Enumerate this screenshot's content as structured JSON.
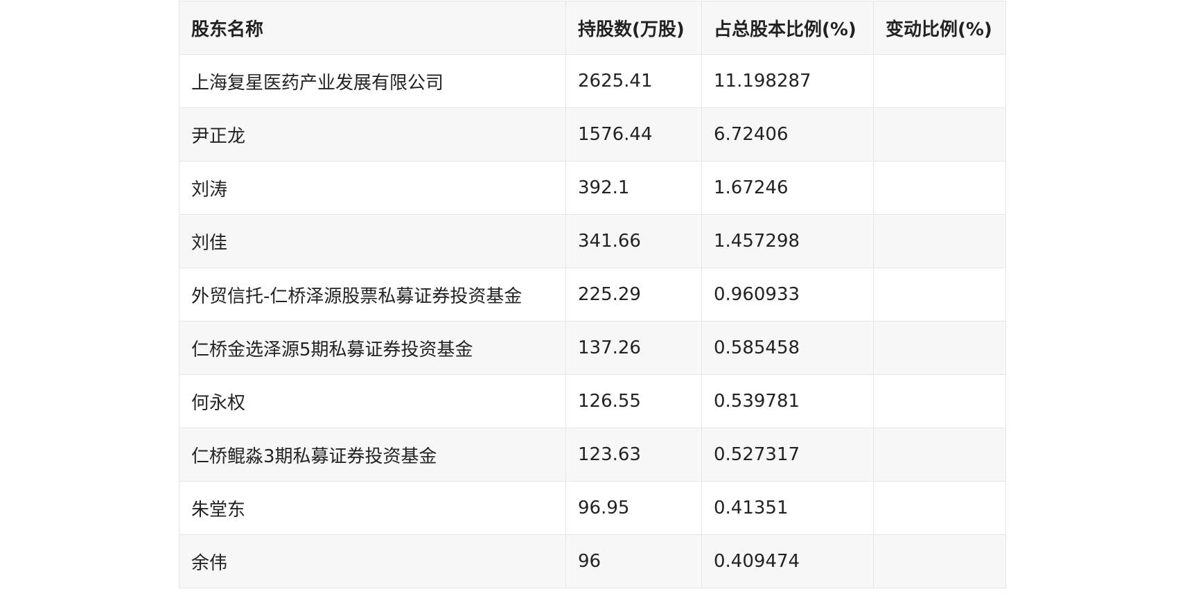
{
  "table": {
    "headers": [
      "股东名称",
      "持股数(万股)",
      "占总股本比例(%)",
      "变动比例(%)"
    ],
    "rows": [
      [
        "上海复星医药产业发展有限公司",
        "2625.41",
        "11.198287",
        ""
      ],
      [
        "尹正龙",
        "1576.44",
        "6.72406",
        ""
      ],
      [
        "刘涛",
        "392.1",
        "1.67246",
        ""
      ],
      [
        "刘佳",
        "341.66",
        "1.457298",
        ""
      ],
      [
        "外贸信托-仁桥泽源股票私募证券投资基金",
        "225.29",
        "0.960933",
        ""
      ],
      [
        "仁桥金选泽源5期私募证券投资基金",
        "137.26",
        "0.585458",
        ""
      ],
      [
        "何永权",
        "126.55",
        "0.539781",
        ""
      ],
      [
        "仁桥鲲淼3期私募证券投资基金",
        "123.63",
        "0.527317",
        ""
      ],
      [
        "朱堂东",
        "96.95",
        "0.41351",
        ""
      ],
      [
        "余伟",
        "96",
        "0.409474",
        ""
      ]
    ]
  }
}
